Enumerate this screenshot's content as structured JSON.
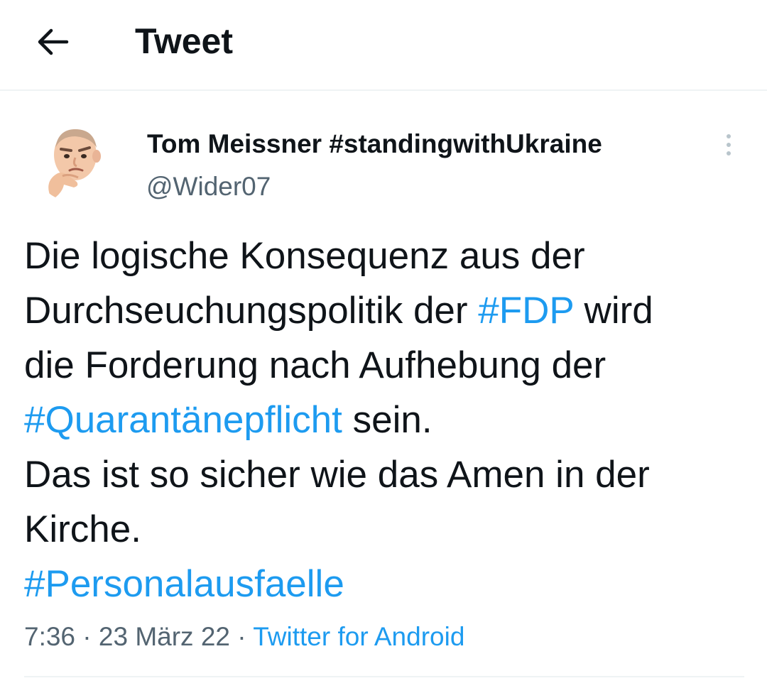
{
  "header": {
    "title": "Tweet",
    "back_icon": "arrow-left-icon"
  },
  "tweet": {
    "author_name": "Tom Meissner #standingwithUkraine",
    "author_handle": "@Wider07",
    "avatar_icon": "memoji-thinking-avatar",
    "more_icon": "vertical-ellipsis-icon",
    "body": {
      "l1": "Die logische Konsequenz aus der",
      "l2_text": "Durchseuchungspolitik der ",
      "l2_tag": "#FDP",
      "l2_tail": " wird",
      "l3": "die Forderung nach Aufhebung der",
      "l4_tag": "#Quarantänepflicht",
      "l4_tail": " sein.",
      "l5": "Das ist so sicher wie das Amen in der",
      "l6": "Kirche.",
      "l7_tag": "#Personalausfaelle"
    },
    "time": "7:36",
    "separator": " · ",
    "date": "23 März 22",
    "source": "Twitter for Android"
  },
  "colors": {
    "accent": "#1d9bf0",
    "text": "#0f1419",
    "secondary": "#536471",
    "divider": "#eff3f4"
  }
}
